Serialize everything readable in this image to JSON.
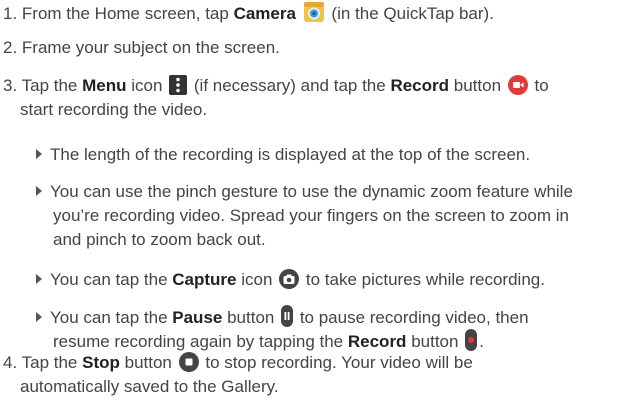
{
  "step1": {
    "num": "1.",
    "pre": "From the Home screen, tap",
    "strong": "Camera",
    "post": "(in the QuickTap bar).",
    "icon": "camera-app-icon"
  },
  "step2": {
    "num": "2.",
    "text": "Frame your subject on the screen."
  },
  "step3": {
    "num": "3.",
    "pre": "Tap the",
    "menu": "Menu",
    "mid1": "icon",
    "mid2": "(if necessary) and tap the",
    "record": "Record",
    "mid3": "button",
    "post": "to",
    "line2": "start recording the video.",
    "menu_icon": "menu-icon",
    "record_icon": "record-video-icon"
  },
  "bullets": [
    {
      "text": "The length of the recording is displayed at the top of the screen."
    },
    {
      "line1": "You can use the pinch gesture to use the dynamic zoom feature while",
      "line2": "you’re recording video. Spread your fingers on the screen to zoom in",
      "line3": "and pinch to zoom back out."
    },
    {
      "pre": "You can tap the",
      "strong": "Capture",
      "mid": "icon",
      "post": "to take pictures while recording.",
      "icon": "capture-icon"
    },
    {
      "pre": "You can tap the",
      "strong": "Pause",
      "mid": "button",
      "post": "to pause recording video, then",
      "line2_pre": "resume recording again by tapping the",
      "line2_strong": "Record",
      "line2_mid": "button",
      "line2_post": ".",
      "icon1": "pause-icon",
      "icon2": "record-icon"
    }
  ],
  "step4": {
    "num": "4.",
    "pre": "Tap the",
    "strong": "Stop",
    "mid": "button",
    "post": "to stop recording. Your video will be",
    "line2": "automatically saved to the Gallery.",
    "icon": "stop-icon"
  },
  "colors": {
    "text": "#444444",
    "icon_dark": "#444444",
    "record_red": "#e03a3a",
    "camera_blue": "#2f9be0",
    "camera_yellow": "#f1c24a"
  }
}
